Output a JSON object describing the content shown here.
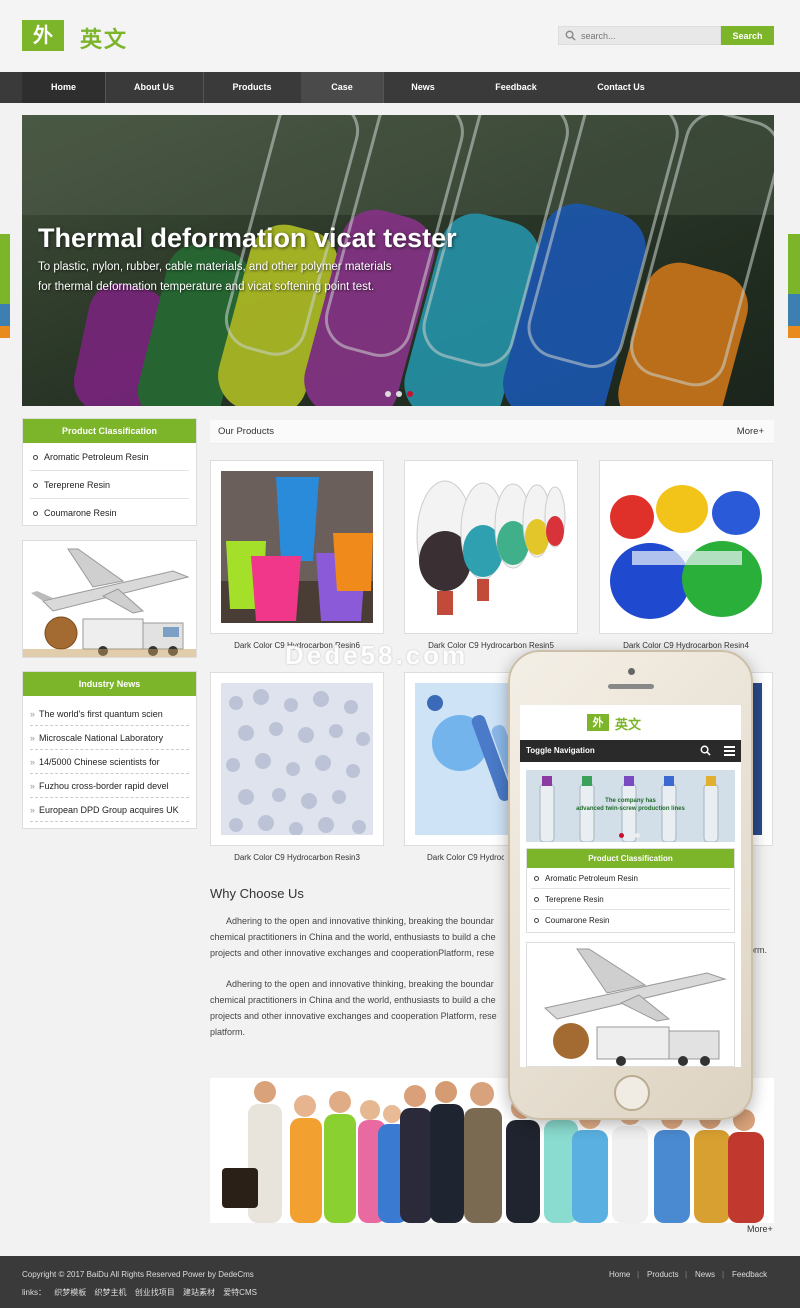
{
  "logo": {
    "mark": "外",
    "text": "英文"
  },
  "search": {
    "placeholder": "search...",
    "button": "Search"
  },
  "nav": [
    "Home",
    "About Us",
    "Products",
    "Case",
    "News",
    "Feedback",
    "Contact Us"
  ],
  "banner": {
    "title": "Thermal deformation vicat tester",
    "line1": "To plastic, nylon, rubber, cable materials, and other polymer materials",
    "line2": "for thermal deformation temperature and vicat softening point test."
  },
  "sidebar": {
    "classification_title": "Product Classification",
    "categories": [
      "Aromatic Petroleum Resin",
      "Tereprene Resin",
      "Coumarone Resin"
    ],
    "news_title": "Industry News",
    "news": [
      "The world's first quantum scien",
      "Microscale National Laboratory",
      "14/5000 Chinese scientists for",
      "Fuzhou cross-border rapid devel",
      "European DPD Group acquires UK"
    ]
  },
  "products": {
    "title": "Our Products",
    "more": "More+",
    "items": [
      "Dark Color C9 Hydrocarbon Resin6",
      "Dark Color C9 Hydrocarbon Resin5",
      "Dark Color C9 Hydrocarbon Resin4",
      "Dark Color C9 Hydrocarbon Resin3",
      "Dark Color C9 Hydrocarbon Resin2"
    ]
  },
  "why": {
    "title": "Why Choose Us",
    "p1a": "Adhering to the open and innovative thinking, breaking the boundar",
    "p1b": "chemical practitioners in China and the world, enthusiasts to build a che",
    "p1c": "projects and other innovative exchanges and cooperationPlatform, rese",
    "p1d": "tform.",
    "p2a": "Adhering to the open and innovative thinking, breaking the boundar",
    "p2b": "chemical practitioners in China and the world, enthusiasts to build a che",
    "p2c": "projects and other innovative exchanges and cooperation Platform, rese",
    "p2d": "platform.",
    "more": "More+"
  },
  "watermark": "Dede58.com",
  "phone": {
    "logo_mark": "外",
    "logo_text": "英文",
    "toggle": "Toggle Navigation",
    "banner_text1": "The company has",
    "banner_text2": "advanced twin-screw production lines",
    "classification_title": "Product Classification",
    "categories": [
      "Aromatic Petroleum Resin",
      "Tereprene Resin",
      "Coumarone Resin"
    ]
  },
  "footer": {
    "copyright": "Copyright © 2017 BaiDu All Rights Reserved Power by DedeCms",
    "links_label": "links：",
    "links": [
      "织梦模板",
      "织梦主机",
      "创业找项目",
      "建站素材",
      "爱特CMS"
    ],
    "nav": [
      "Home",
      "Products",
      "News",
      "Feedback"
    ]
  },
  "colors": {
    "accent": "#7db52a",
    "nav_bg": "#3a3a3a"
  }
}
